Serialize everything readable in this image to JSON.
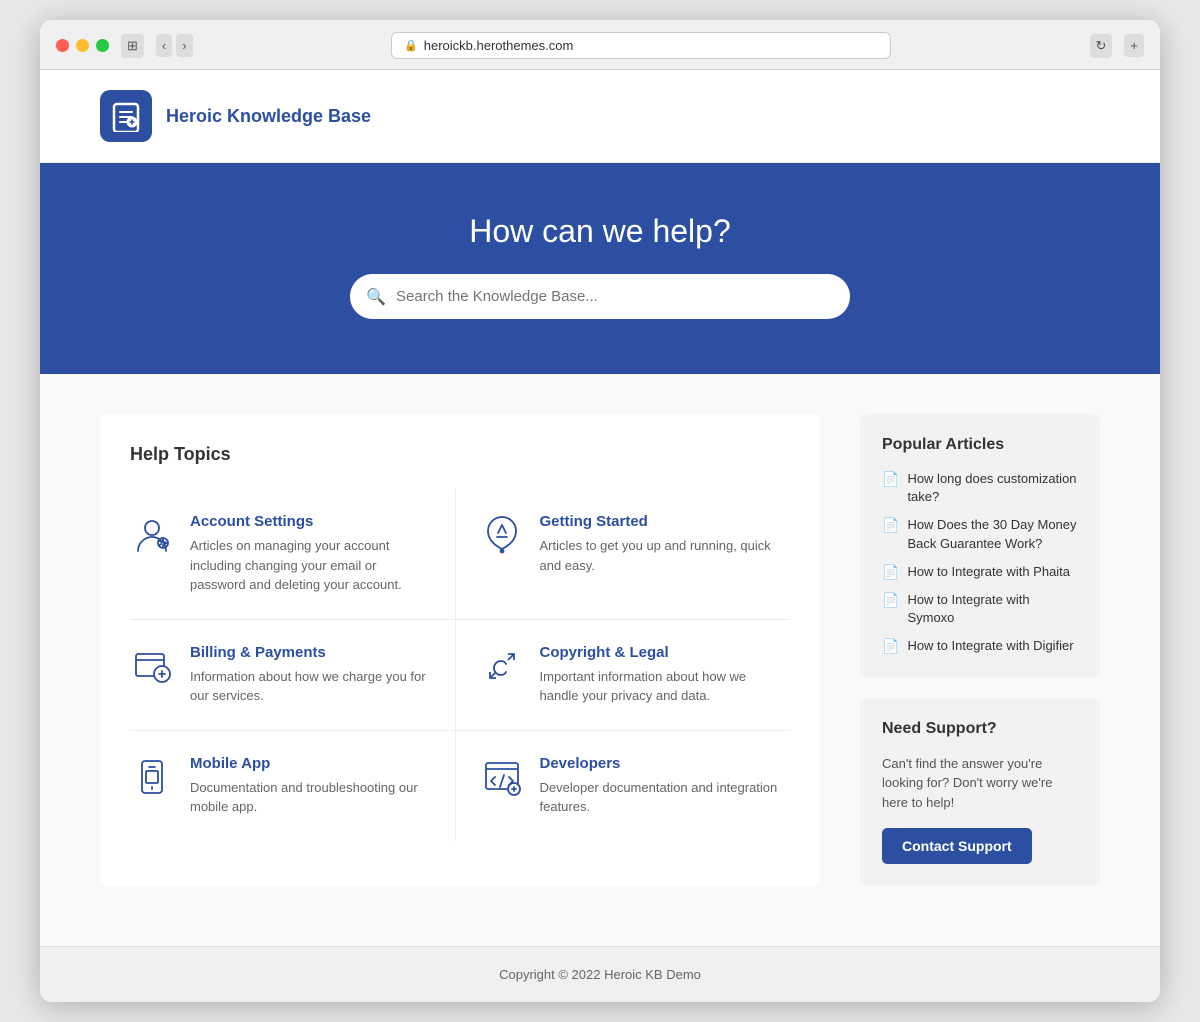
{
  "browser": {
    "url": "heroickb.herothemes.com",
    "back_label": "‹",
    "forward_label": "›"
  },
  "header": {
    "logo_text": "Heroic Knowledge Base",
    "logo_icon_symbol": "📘"
  },
  "hero": {
    "title": "How can we help?",
    "search_placeholder": "Search the Knowledge Base..."
  },
  "help_topics": {
    "section_title": "Help Topics",
    "topics": [
      {
        "id": "account-settings",
        "name": "Account Settings",
        "description": "Articles on managing your account including changing your email or password and deleting your account."
      },
      {
        "id": "getting-started",
        "name": "Getting Started",
        "description": "Articles to get you up and running, quick and easy."
      },
      {
        "id": "billing-payments",
        "name": "Billing & Payments",
        "description": "Information about how we charge you for our services."
      },
      {
        "id": "copyright-legal",
        "name": "Copyright & Legal",
        "description": "Important information about how we handle your privacy and data."
      },
      {
        "id": "mobile-app",
        "name": "Mobile App",
        "description": "Documentation and troubleshooting our mobile app."
      },
      {
        "id": "developers",
        "name": "Developers",
        "description": "Developer documentation and integration features."
      }
    ]
  },
  "sidebar": {
    "popular_articles": {
      "title": "Popular Articles",
      "articles": [
        {
          "text": "How long does customization take?"
        },
        {
          "text": "How Does the 30 Day Money Back Guarantee Work?"
        },
        {
          "text": "How to Integrate with Phaita"
        },
        {
          "text": "How to Integrate with Symoxo"
        },
        {
          "text": "How to Integrate with Digifier"
        }
      ]
    },
    "need_support": {
      "title": "Need Support?",
      "description": "Can't find the answer you're looking for? Don't worry we're here to help!",
      "button_label": "Contact Support"
    }
  },
  "footer": {
    "copyright": "Copyright © 2022 Heroic KB Demo"
  }
}
